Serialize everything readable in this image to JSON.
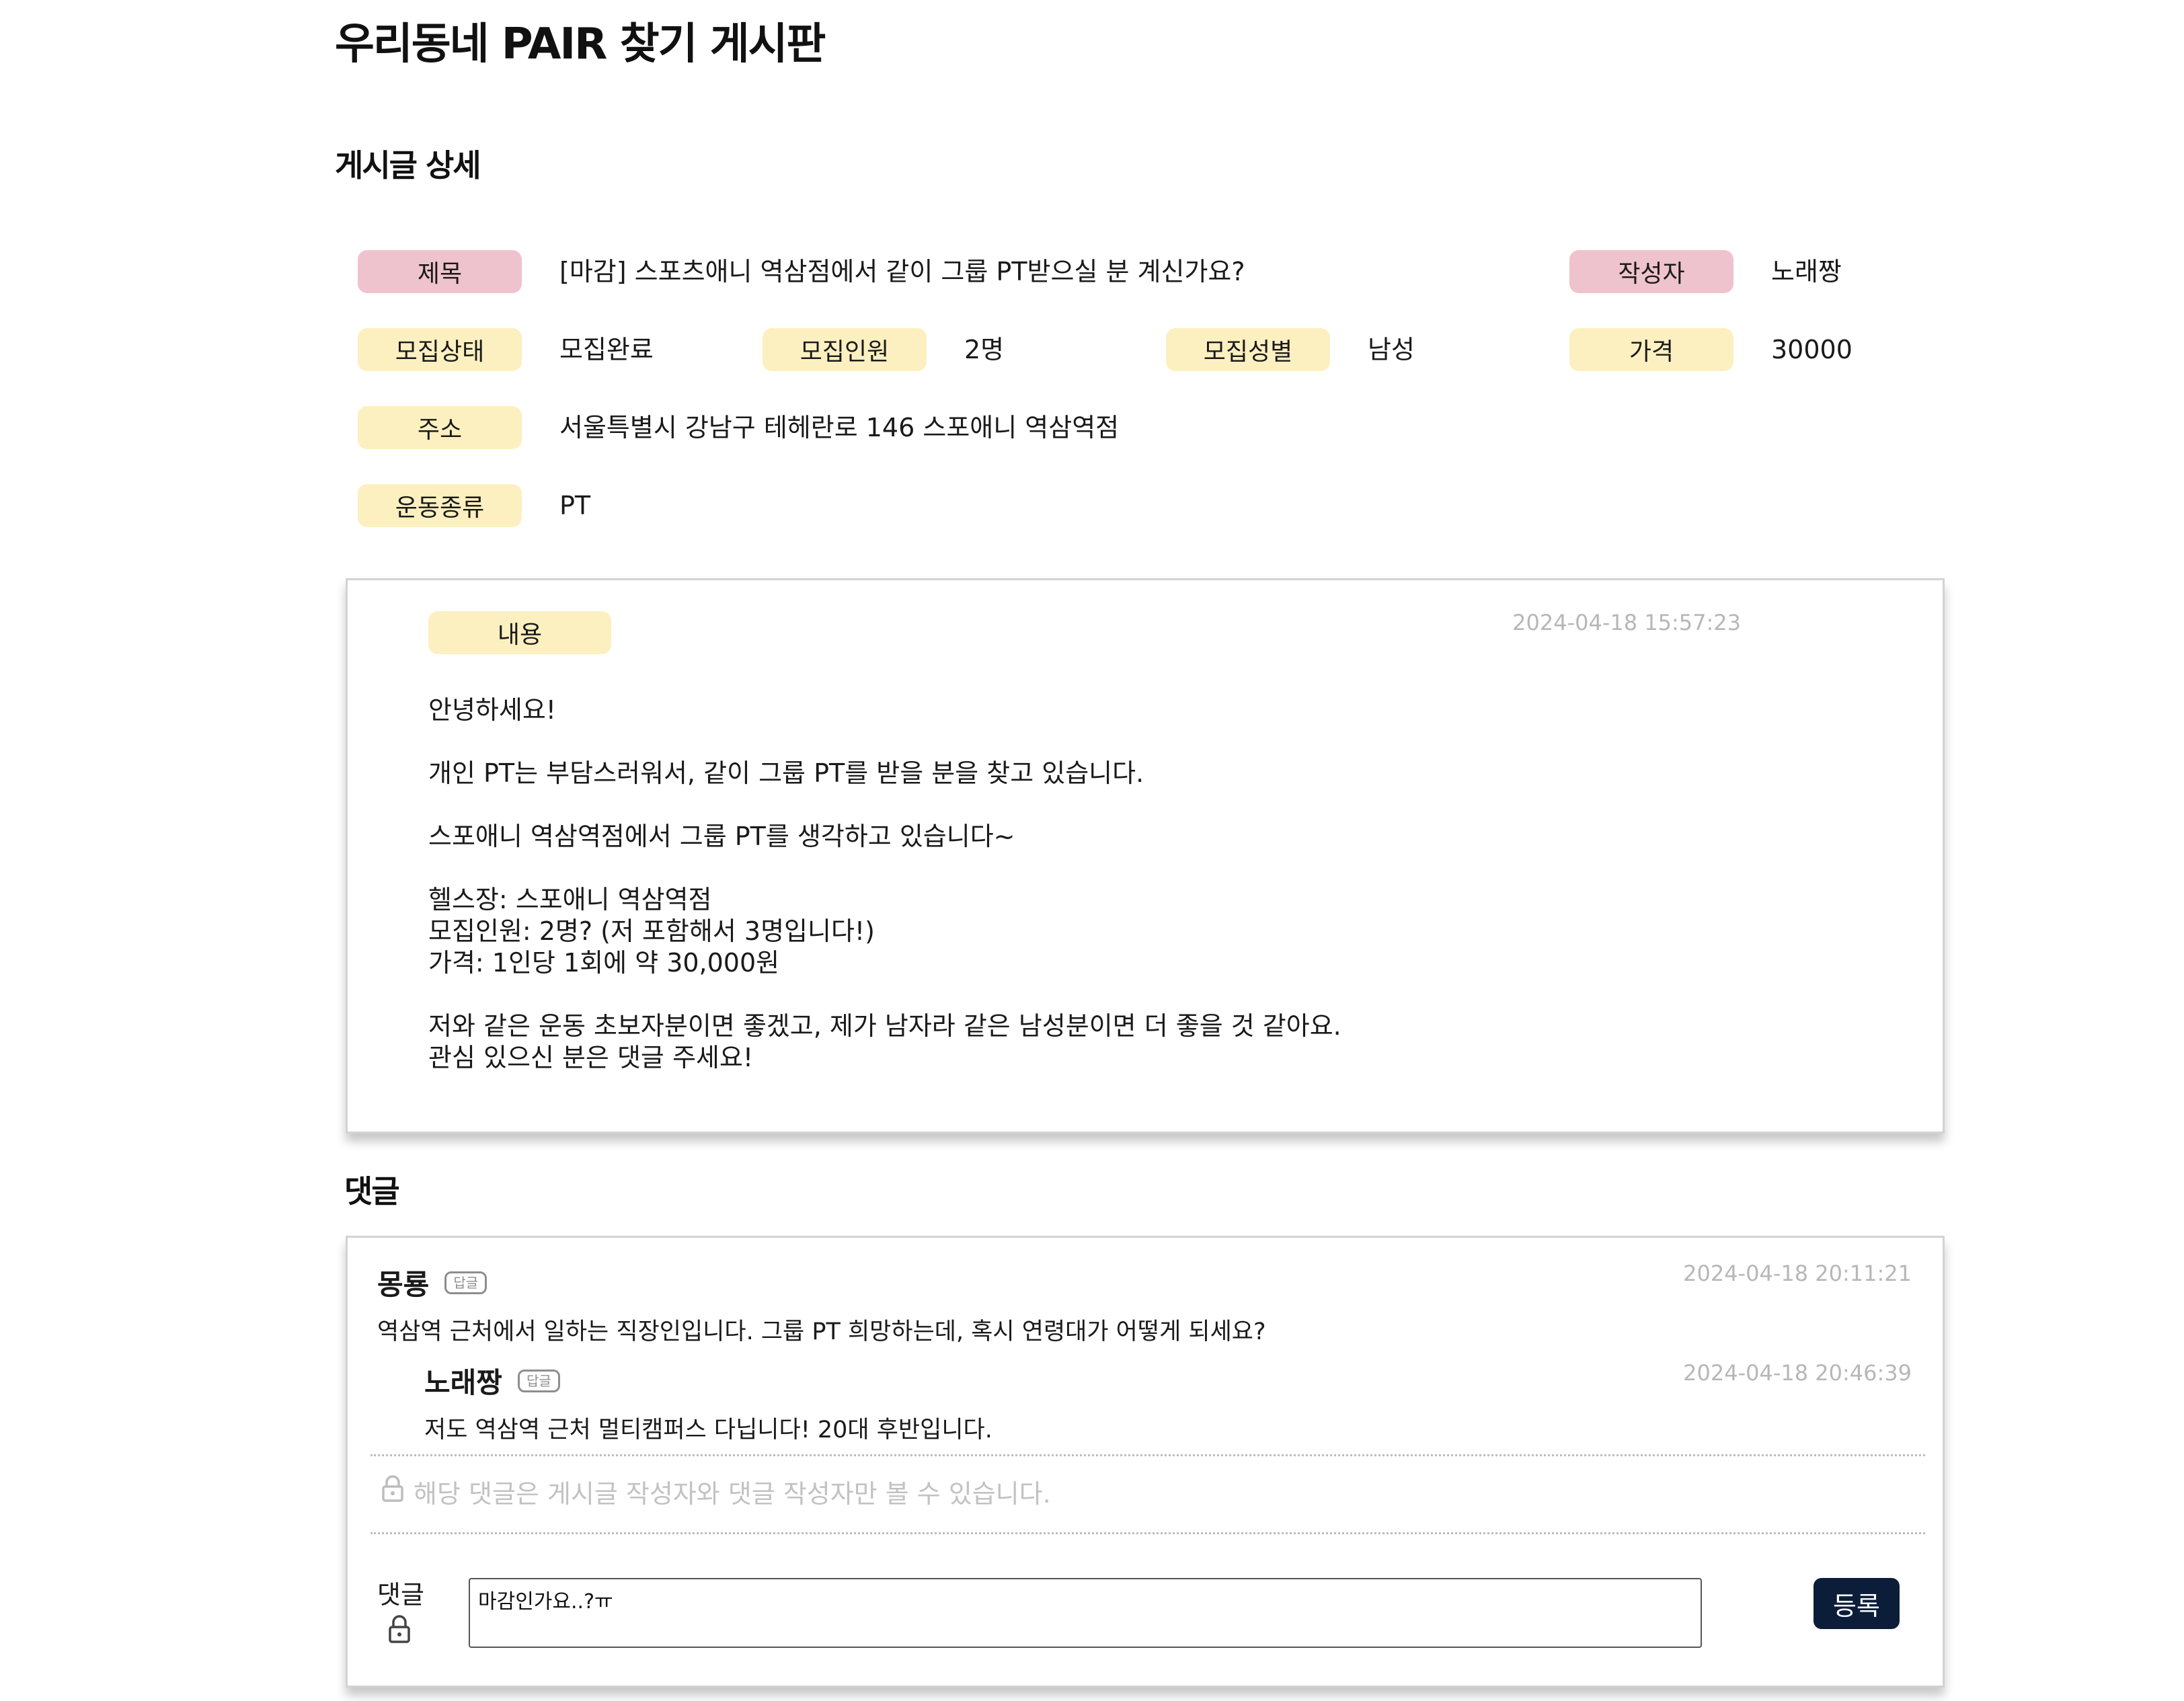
{
  "site": {
    "title": "우리동네 PAIR 찾기 게시판"
  },
  "detail": {
    "heading": "게시글 상세",
    "title_label": "제목",
    "title_value": "[마감] 스포츠애니 역삼점에서 같이 그룹 PT받으실 분 계신가요?",
    "author_label": "작성자",
    "author_value": "노래짱",
    "status_label": "모집상태",
    "status_value": "모집완료",
    "count_label": "모집인원",
    "count_value": "2명",
    "gender_label": "모집성별",
    "gender_value": "남성",
    "price_label": "가격",
    "price_value": "30000",
    "address_label": "주소",
    "address_value": "서울특별시 강남구 테헤란로 146 스포애니 역삼역점",
    "sport_label": "운동종류",
    "sport_value": "PT"
  },
  "content": {
    "label": "내용",
    "date": "2024-04-18 15:57:23",
    "paragraphs": [
      "안녕하세요!",
      "개인 PT는 부담스러워서, 같이 그룹 PT를 받을 분을 찾고 있습니다.",
      "스포애니 역삼역점에서 그룹 PT를 생각하고 있습니다~",
      "헬스장: 스포애니 역삼역점\n모집인원: 2명? (저 포함해서 3명입니다!)\n가격: 1인당 1회에 약 30,000원",
      "저와 같은 운동 초보자분이면 좋겠고, 제가 남자라 같은 남성분이면 더 좋을 것 같아요.\n관심 있으신 분은 댓글 주세요!"
    ]
  },
  "comments": {
    "heading": "댓글",
    "items": [
      {
        "author": "몽룡",
        "reply_tag": "답글",
        "date": "2024-04-18 20:11:21",
        "text": "역삼역 근처에서 일하는 직장인입니다. 그룹 PT 희망하는데, 혹시 연령대가 어떻게 되세요?"
      },
      {
        "author": "노래짱",
        "reply_tag": "답글",
        "date": "2024-04-18 20:46:39",
        "text": "저도 역삼역 근처 멀티캠퍼스 다닙니다! 20대 후반입니다."
      }
    ],
    "private_notice": "해당 댓글은 게시글 작성자와 댓글 작성자만 볼 수 있습니다.",
    "input_label": "댓글",
    "input_value": "마감인가요..?ㅠ",
    "submit_label": "등록"
  },
  "colors": {
    "pink_badge": "#efc3cd",
    "yellow_badge": "#fdf0c0",
    "submit_button": "#0c1d3a"
  },
  "icons": {
    "lock": "lock-icon"
  }
}
